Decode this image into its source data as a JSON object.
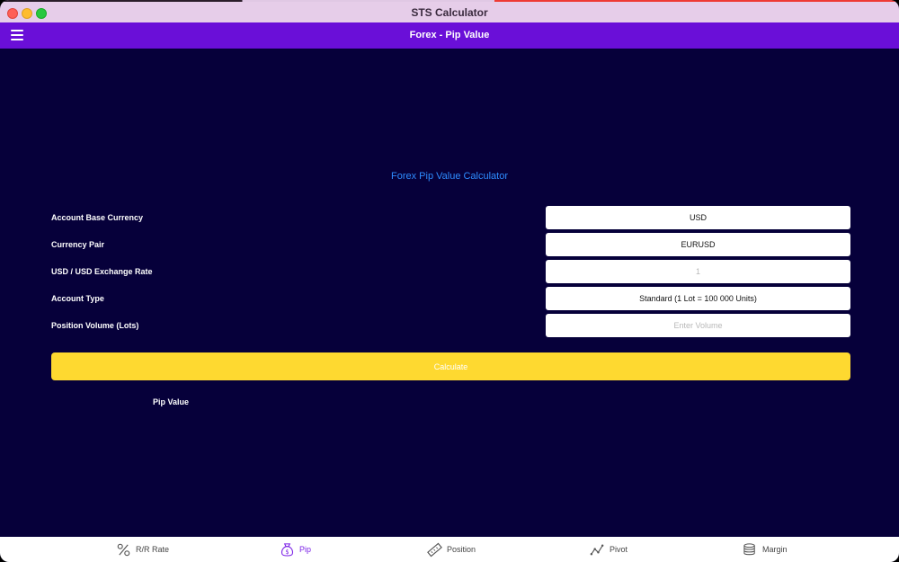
{
  "window": {
    "title": "STS Calculator"
  },
  "appbar": {
    "title": "Forex - Pip Value"
  },
  "calculator": {
    "heading": "Forex Pip Value Calculator",
    "rows": [
      {
        "label": "Account Base Currency",
        "value": "USD"
      },
      {
        "label": "Currency Pair",
        "value": "EURUSD"
      },
      {
        "label": "USD / USD Exchange Rate",
        "value": "1"
      },
      {
        "label": "Account Type",
        "value": "Standard (1 Lot = 100 000 Units)"
      },
      {
        "label": "Position Volume (Lots)",
        "placeholder": "Enter Volume"
      }
    ],
    "calculate_label": "Calculate",
    "result_label": "Pip Value"
  },
  "tabs": [
    {
      "label": "R/R Rate",
      "icon": "percent-icon",
      "active": false
    },
    {
      "label": "Pip",
      "icon": "money-bag-icon",
      "active": true
    },
    {
      "label": "Position",
      "icon": "ruler-icon",
      "active": false
    },
    {
      "label": "Pivot",
      "icon": "pivot-chart-icon",
      "active": false
    },
    {
      "label": "Margin",
      "icon": "coins-stack-icon",
      "active": false
    }
  ],
  "colors": {
    "background": "#06003a",
    "appbar": "#6a0fd8",
    "accent_yellow": "#fed930",
    "heading_blue": "#2e8cff",
    "active_tab": "#7a1fe6"
  }
}
